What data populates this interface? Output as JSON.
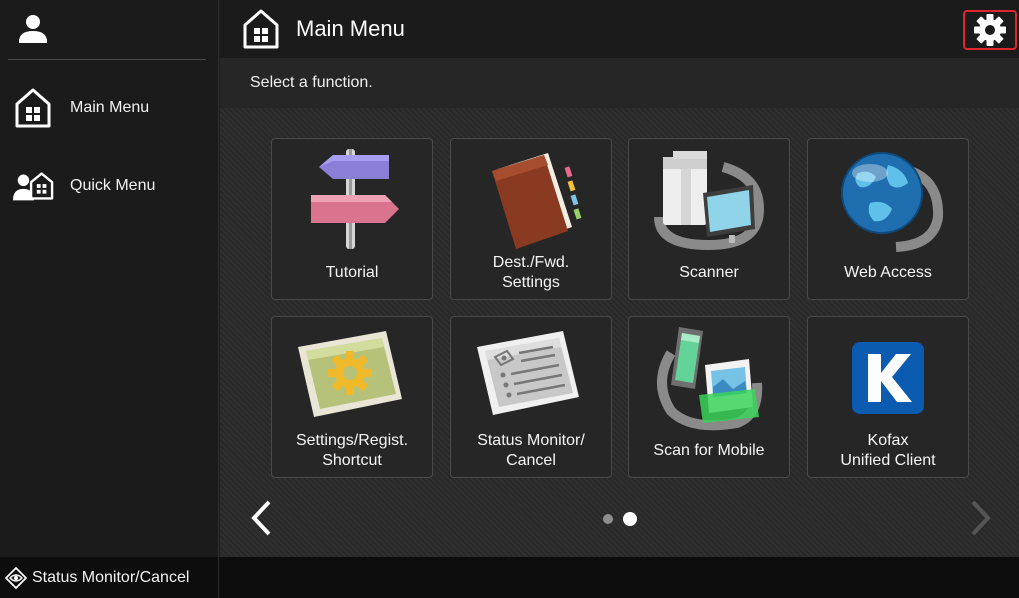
{
  "header": {
    "title": "Main Menu",
    "settings_icon": "gear-icon",
    "home_icon": "home-icon"
  },
  "sidebar": {
    "user_icon": "user-icon",
    "items": [
      {
        "label": "Main Menu",
        "icon": "home-icon"
      },
      {
        "label": "Quick Menu",
        "icon": "quick-menu-icon"
      }
    ]
  },
  "main": {
    "instruction": "Select a function.",
    "tiles": [
      {
        "label": "Tutorial",
        "icon": "signpost-icon"
      },
      {
        "label": "Dest./Fwd.\nSettings",
        "icon": "address-book-icon"
      },
      {
        "label": "Scanner",
        "icon": "scanner-icon"
      },
      {
        "label": "Web Access",
        "icon": "globe-icon"
      },
      {
        "label": "Settings/Regist.\nShortcut",
        "icon": "settings-gear-screen-icon"
      },
      {
        "label": "Status Monitor/\nCancel",
        "icon": "status-monitor-icon"
      },
      {
        "label": "Scan for Mobile",
        "icon": "mobile-scan-icon"
      },
      {
        "label": "Kofax\nUnified Client",
        "icon": "kofax-icon"
      }
    ],
    "pager": {
      "current": 2,
      "total": 2
    }
  },
  "footer": {
    "status_label": "Status Monitor/Cancel",
    "status_icon": "eye-diamond-icon"
  },
  "colors": {
    "accent_border": "#e0262d",
    "background": "#1c1c1c",
    "tile_border": "#4a4a4a"
  }
}
